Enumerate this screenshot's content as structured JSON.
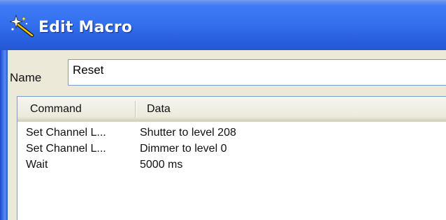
{
  "window": {
    "title": "Edit Macro",
    "icon": "magic-wand-icon"
  },
  "form": {
    "name_label": "Name",
    "name_value": "Reset"
  },
  "commands_table": {
    "columns": [
      "Command",
      "Data"
    ],
    "rows": [
      {
        "command": "Set Channel L...",
        "data": "Shutter to level 208"
      },
      {
        "command": "Set Channel L...",
        "data": "Dimmer to level 0"
      },
      {
        "command": "Wait",
        "data": "5000 ms"
      }
    ]
  },
  "colors": {
    "titlebar": "#3471ee",
    "dialog_face": "#ece9d8",
    "input_border": "#7f9db9"
  }
}
